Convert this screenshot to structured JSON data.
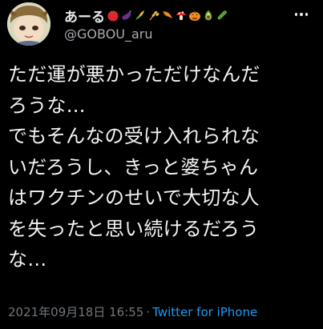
{
  "author": {
    "display_name": "あーる",
    "handle": "@GOBOU_aru",
    "name_emojis": [
      "tomato-icon",
      "eggplant-icon",
      "corn-icon",
      "wheat-icon",
      "pepper-icon",
      "mushroom-icon",
      "pumpkin-icon",
      "avocado-icon",
      "cucumber-icon"
    ],
    "more_label": "…"
  },
  "tweet": {
    "lines": [
      "ただ運が悪かっただけなんだ",
      "ろうな…",
      "でもそんなの受け入れられな",
      "いだろうし、きっと婆ちゃん",
      "はワクチンのせいで大切な人",
      "を失ったと思い続けるだろう",
      "な…"
    ]
  },
  "meta": {
    "timestamp": "2021年09月18日 16:55",
    "separator": "·",
    "source": "Twitter for iPhone"
  },
  "colors": {
    "background": "#000000",
    "text": "#e7e9ea",
    "secondary": "#71767b",
    "link": "#1d9bf0"
  }
}
